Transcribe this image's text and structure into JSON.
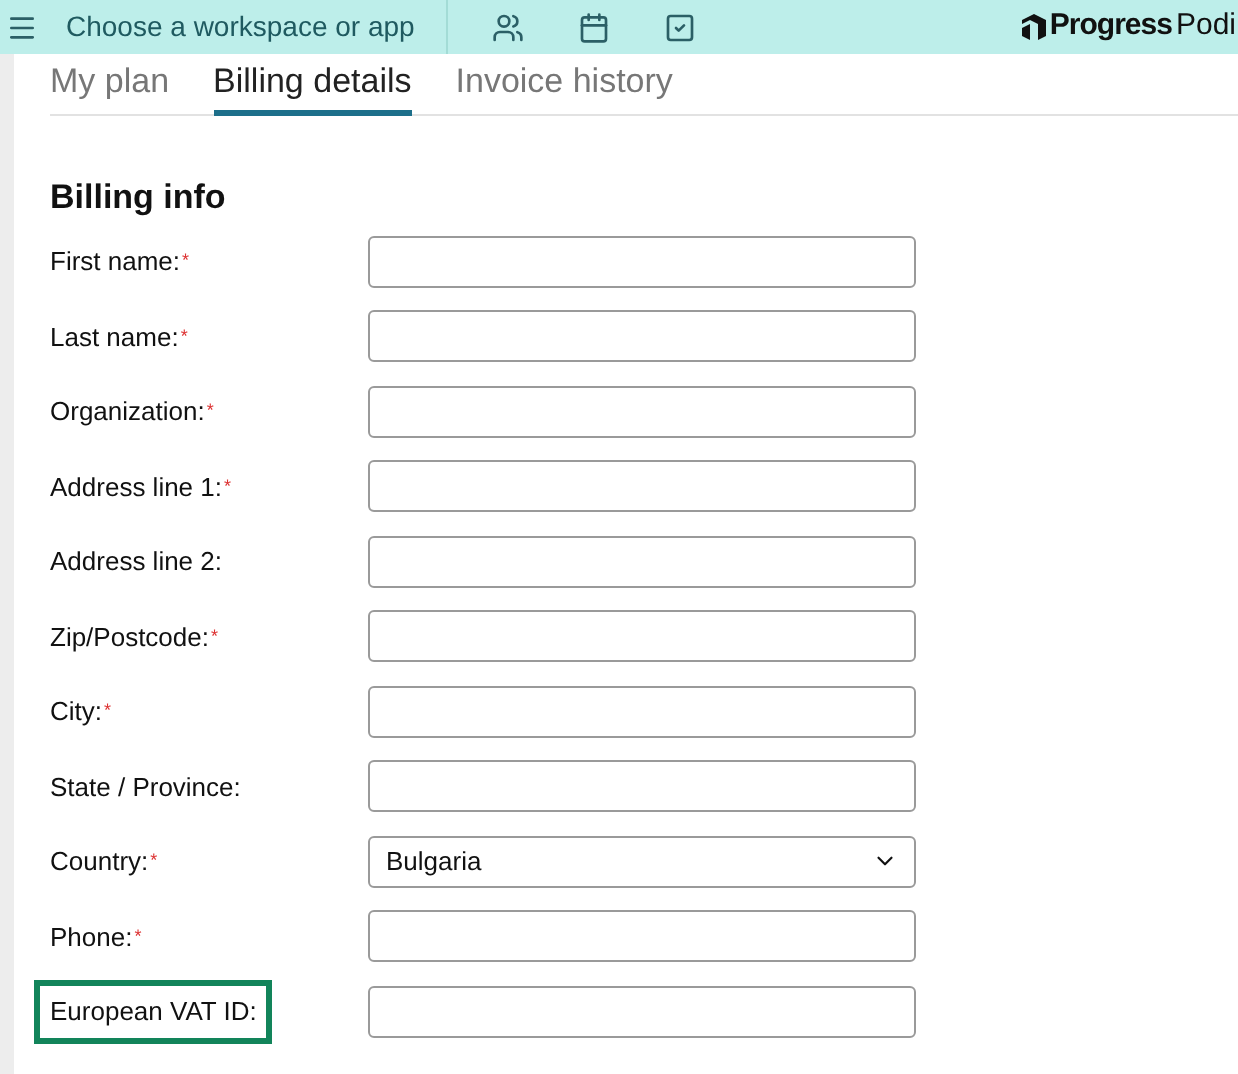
{
  "header": {
    "workspace_label": "Choose a workspace or app",
    "logo": {
      "brand": "Progress",
      "product": "Podi"
    }
  },
  "tabs": [
    {
      "label": "My plan",
      "selected": false
    },
    {
      "label": "Billing details",
      "selected": true
    },
    {
      "label": "Invoice history",
      "selected": false
    }
  ],
  "section_title": "Billing info",
  "fields": [
    {
      "kind": "text",
      "label": "First name:",
      "marker": "*",
      "highlighted": false
    },
    {
      "kind": "text",
      "label": "Last name:",
      "marker": "*",
      "highlighted": false
    },
    {
      "kind": "text",
      "label": "Organization:",
      "marker": "*",
      "highlighted": false
    },
    {
      "kind": "text",
      "label": "Address line 1:",
      "marker": "*",
      "highlighted": false
    },
    {
      "kind": "text",
      "label": "Address line 2:",
      "highlighted": false
    },
    {
      "kind": "text",
      "label": "Zip/Postcode:",
      "marker": "*",
      "highlighted": false
    },
    {
      "kind": "text",
      "label": "City:",
      "marker": "*",
      "highlighted": false
    },
    {
      "kind": "text",
      "label": "State / Province:",
      "highlighted": false
    },
    {
      "kind": "select",
      "label": "Country:",
      "marker": "*",
      "value": "Bulgaria",
      "highlighted": false
    },
    {
      "kind": "text",
      "label": "Phone:",
      "marker": "*",
      "highlighted": false
    },
    {
      "kind": "text",
      "label": "European VAT ID:",
      "highlighted": true
    }
  ]
}
